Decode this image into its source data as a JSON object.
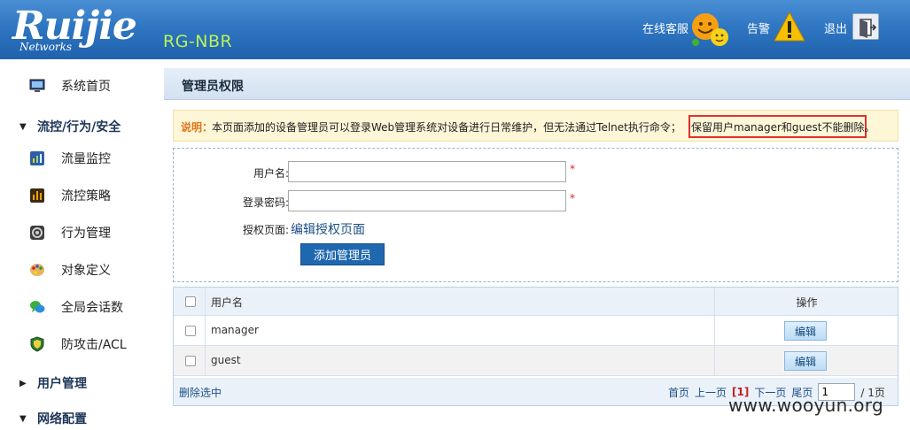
{
  "header": {
    "logo_text": "Ruijie",
    "logo_sub": "Networks",
    "model": "RG-NBR",
    "service_label": "在线客服",
    "alarm_label": "告警",
    "exit_label": "退出",
    "brand_color": "#2f76c2",
    "model_color": "#b8f25a"
  },
  "sidebar": {
    "items": [
      {
        "label": "系统首页",
        "icon": "monitor-icon"
      },
      {
        "label": "流控/行为/安全",
        "group": true,
        "expanded": true
      },
      {
        "label": "流量监控",
        "icon": "chart-icon"
      },
      {
        "label": "流控策略",
        "icon": "bars-icon"
      },
      {
        "label": "行为管理",
        "icon": "gear-icon"
      },
      {
        "label": "对象定义",
        "icon": "palette-icon"
      },
      {
        "label": "全局会话数",
        "icon": "chat-icon"
      },
      {
        "label": "防攻击/ACL",
        "icon": "shield-icon"
      },
      {
        "label": "用户管理",
        "group": true,
        "expanded": false
      },
      {
        "label": "网络配置",
        "group": true,
        "expanded": true
      }
    ]
  },
  "main": {
    "title": "管理员权限",
    "notice": {
      "lead": "说明：",
      "text": "本页面添加的设备管理员可以登录Web管理系统对设备进行日常维护，但无法通过Telnet执行命令；",
      "highlight": "保留用户manager和guest不能删除。"
    },
    "form": {
      "username_label": "用户名:",
      "username_value": "",
      "password_label": "登录密码:",
      "password_value": "",
      "required_mark": "*",
      "auth_label": "授权页面:",
      "auth_link": "编辑授权页面",
      "add_button": "添加管理员"
    },
    "table": {
      "col_name": "用户名",
      "col_op": "操作",
      "rows": [
        {
          "name": "manager",
          "action": "编辑"
        },
        {
          "name": "guest",
          "action": "编辑"
        }
      ],
      "delete_selected": "删除选中",
      "pager": {
        "first": "首页",
        "prev": "上一页",
        "current": "[1]",
        "next": "下一页",
        "last": "尾页",
        "page_input": "1",
        "total": "/ 1页"
      }
    }
  },
  "watermark": "www.wooyun.org"
}
